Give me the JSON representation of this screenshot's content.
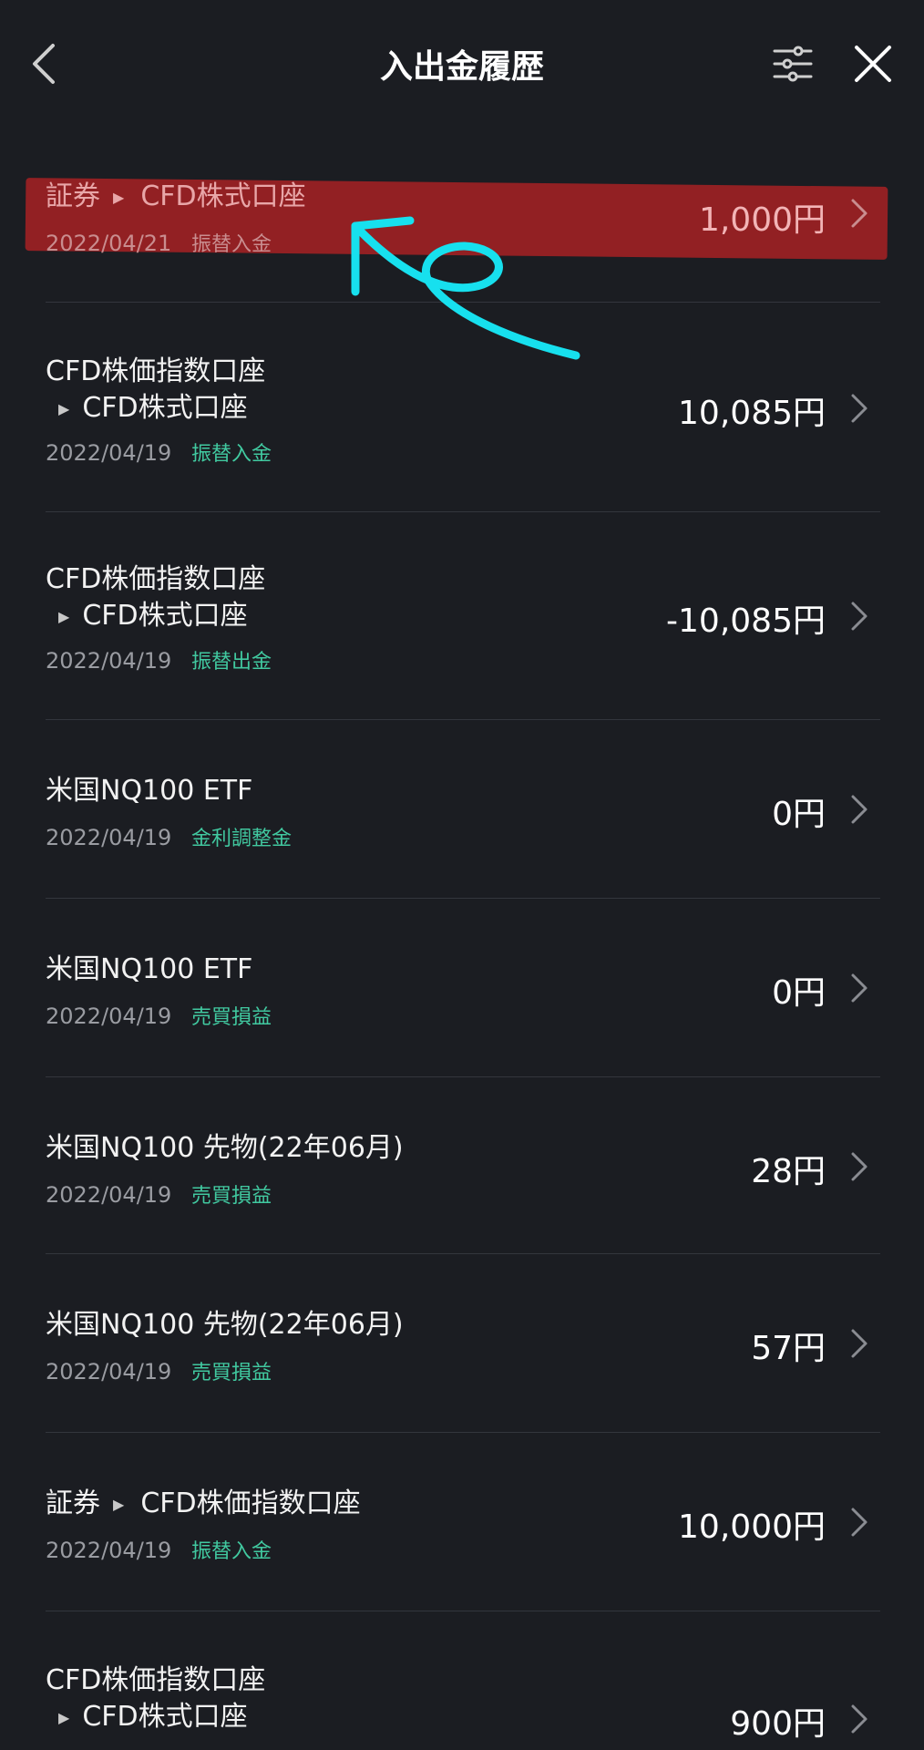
{
  "header": {
    "title": "入出金履歴",
    "back_icon": "chevron-left-icon",
    "filter_icon": "sliders-icon",
    "close_icon": "close-icon"
  },
  "colors": {
    "background": "#1b1d22",
    "type_tag": "#41c9a0",
    "highlight": "#9b2024",
    "annotation_arrow": "#17e0ee"
  },
  "transactions": [
    {
      "name": "証券",
      "arrow": "▶",
      "sub": "CFD株式口座",
      "date": "2022/04/21",
      "type": "振替入金",
      "amount": "1,000円"
    },
    {
      "name": "CFD株価指数口座",
      "arrow": "▶",
      "sub": "CFD株式口座",
      "date": "2022/04/19",
      "type": "振替入金",
      "amount": "10,085円"
    },
    {
      "name": "CFD株価指数口座",
      "arrow": "▶",
      "sub": "CFD株式口座",
      "date": "2022/04/19",
      "type": "振替出金",
      "amount": "-10,085円"
    },
    {
      "name": "米国NQ100 ETF",
      "date": "2022/04/19",
      "type": "金利調整金",
      "amount": "0円"
    },
    {
      "name": "米国NQ100 ETF",
      "date": "2022/04/19",
      "type": "売買損益",
      "amount": "0円"
    },
    {
      "name": "米国NQ100 先物(22年06月)",
      "date": "2022/04/19",
      "type": "売買損益",
      "amount": "28円"
    },
    {
      "name": "米国NQ100 先物(22年06月)",
      "date": "2022/04/19",
      "type": "売買損益",
      "amount": "57円"
    },
    {
      "name": "証券",
      "arrow": "▶",
      "sub": "CFD株価指数口座",
      "date": "2022/04/19",
      "type": "振替入金",
      "amount": "10,000円"
    },
    {
      "name": "CFD株価指数口座",
      "arrow": "▶",
      "sub": "CFD株式口座",
      "date": "",
      "type": "",
      "amount": "900円"
    }
  ]
}
